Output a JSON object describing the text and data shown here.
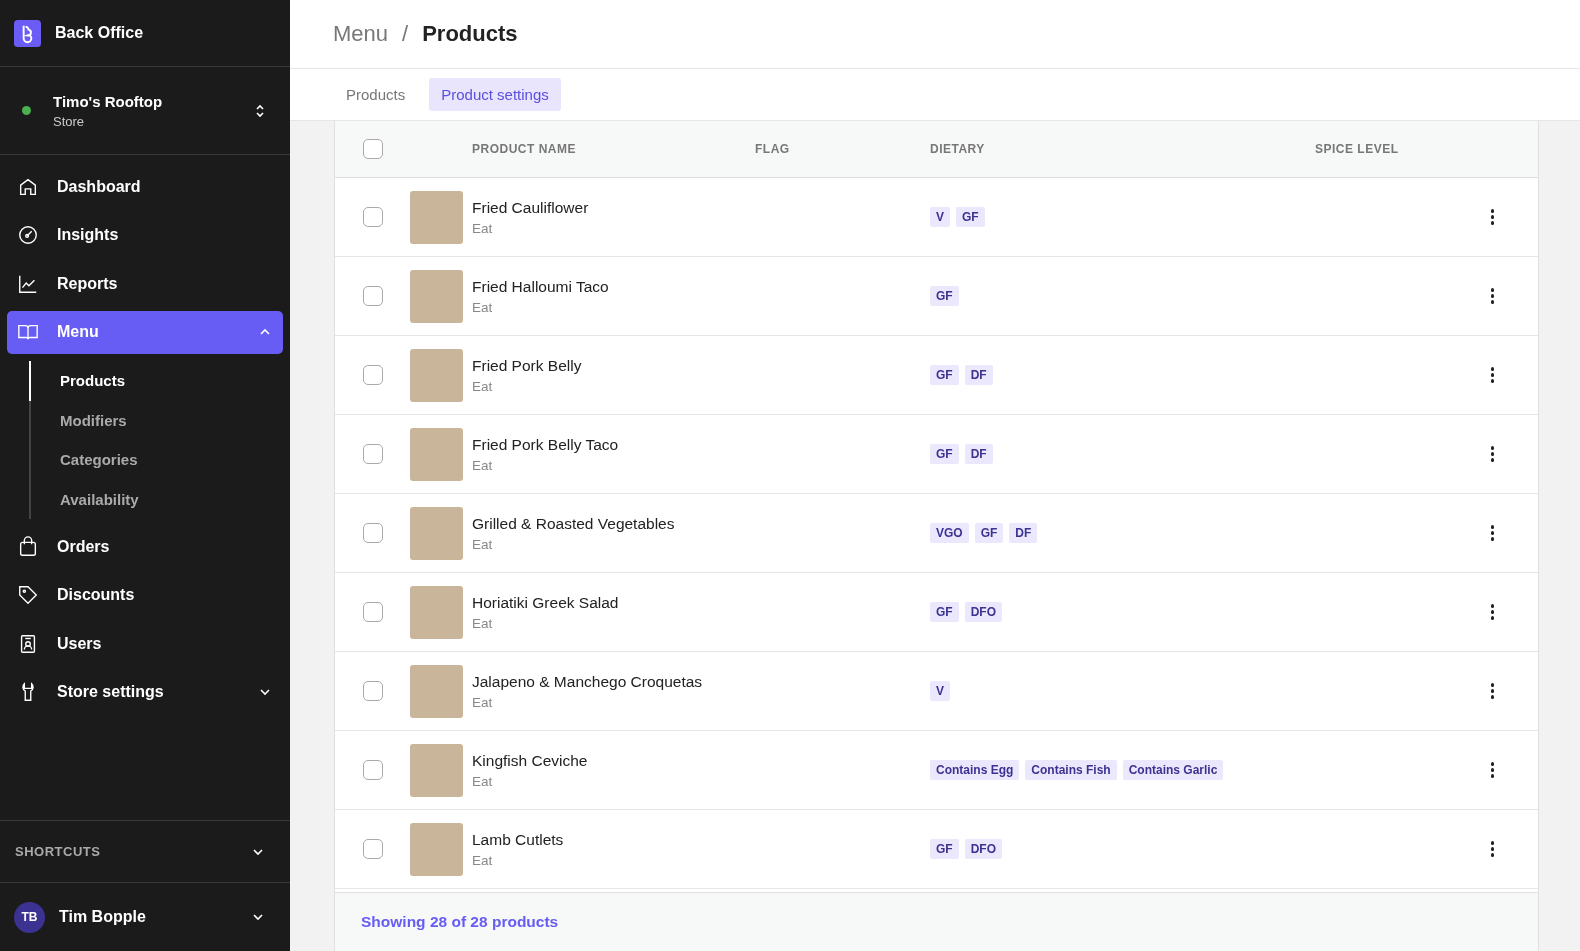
{
  "sidebar": {
    "app_title": "Back Office",
    "store": {
      "name": "Timo's Rooftop",
      "type": "Store",
      "online": true
    },
    "nav": [
      {
        "kind": "home",
        "label": "Dashboard",
        "selected": false
      },
      {
        "kind": "gauge",
        "label": "Insights",
        "selected": false
      },
      {
        "kind": "chart",
        "label": "Reports",
        "selected": false
      },
      {
        "kind": "book",
        "label": "Menu",
        "selected": true,
        "expanded": true,
        "children": [
          {
            "label": "Products",
            "selected": true
          },
          {
            "label": "Modifiers",
            "selected": false
          },
          {
            "label": "Categories",
            "selected": false
          },
          {
            "label": "Availability",
            "selected": false
          }
        ]
      },
      {
        "kind": "bag",
        "label": "Orders",
        "selected": false
      },
      {
        "kind": "tag",
        "label": "Discounts",
        "selected": false
      },
      {
        "kind": "badge",
        "label": "Users",
        "selected": false
      },
      {
        "kind": "wrench",
        "label": "Store settings",
        "selected": false,
        "expanded": false
      }
    ],
    "shortcuts": {
      "label": "SHORTCUTS",
      "expanded": false
    },
    "user": {
      "initials": "TB",
      "name": "Tim Bopple"
    }
  },
  "breadcrumb": {
    "items": [
      "Menu",
      "Products"
    ],
    "separator": "/"
  },
  "tabs": [
    {
      "label": "Products",
      "selected": false
    },
    {
      "label": "Product settings",
      "selected": true
    }
  ],
  "table": {
    "all_checked": false,
    "columns": [
      "PRODUCT NAME",
      "FLAG",
      "DIETARY",
      "SPICE LEVEL"
    ],
    "rows": [
      {
        "name": "Fried Cauliflower",
        "category": "Eat",
        "checked": false,
        "dietary": [
          "V",
          "GF"
        ]
      },
      {
        "name": "Fried Halloumi Taco",
        "category": "Eat",
        "checked": false,
        "dietary": [
          "GF"
        ]
      },
      {
        "name": "Fried Pork Belly",
        "category": "Eat",
        "checked": false,
        "dietary": [
          "GF",
          "DF"
        ]
      },
      {
        "name": "Fried Pork Belly Taco",
        "category": "Eat",
        "checked": false,
        "dietary": [
          "GF",
          "DF"
        ]
      },
      {
        "name": "Grilled & Roasted Vegetables",
        "category": "Eat",
        "checked": false,
        "dietary": [
          "VGO",
          "GF",
          "DF"
        ]
      },
      {
        "name": "Horiatiki Greek Salad",
        "category": "Eat",
        "checked": false,
        "dietary": [
          "GF",
          "DFO"
        ]
      },
      {
        "name": "Jalapeno & Manchego Croquetas",
        "category": "Eat",
        "checked": false,
        "dietary": [
          "V"
        ]
      },
      {
        "name": "Kingfish Ceviche",
        "category": "Eat",
        "checked": false,
        "dietary": [
          "Contains Egg",
          "Contains Fish",
          "Contains Garlic"
        ]
      },
      {
        "name": "Lamb Cutlets",
        "category": "Eat",
        "checked": false,
        "dietary": [
          "GF",
          "DFO"
        ]
      }
    ],
    "footer": "Showing 28 of 28 products"
  }
}
